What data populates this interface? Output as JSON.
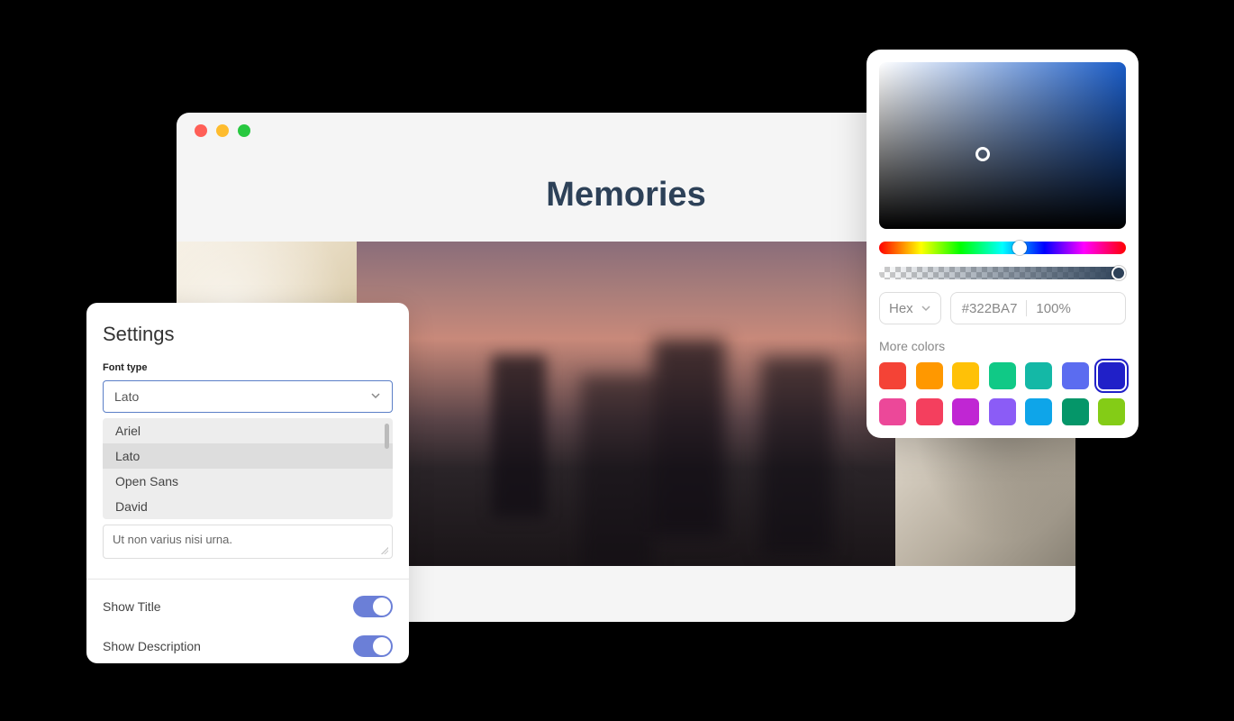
{
  "browser": {
    "page_title": "Memories"
  },
  "settings": {
    "title": "Settings",
    "font_type_label": "Font type",
    "selected_font": "Lato",
    "font_options": [
      "Ariel",
      "Lato",
      "Open Sans",
      "David"
    ],
    "description_text": "Ut non varius nisi urna.",
    "show_title_label": "Show Title",
    "show_title_on": true,
    "show_description_label": "Show Description",
    "show_description_on": true
  },
  "color_picker": {
    "format_label": "Hex",
    "hex_value": "#322BA7",
    "alpha_value": "100%",
    "more_colors_label": "More colors",
    "swatches_row1": [
      "#f44336",
      "#ff9800",
      "#ffc107",
      "#10c986",
      "#14b8a6",
      "#5b6cf0",
      "#2020c8"
    ],
    "swatches_row2": [
      "#ec4899",
      "#f43f5e",
      "#c026d3",
      "#8b5cf6",
      "#0ea5e9",
      "#059669",
      "#84cc16"
    ],
    "selected_swatch_index": 6
  }
}
